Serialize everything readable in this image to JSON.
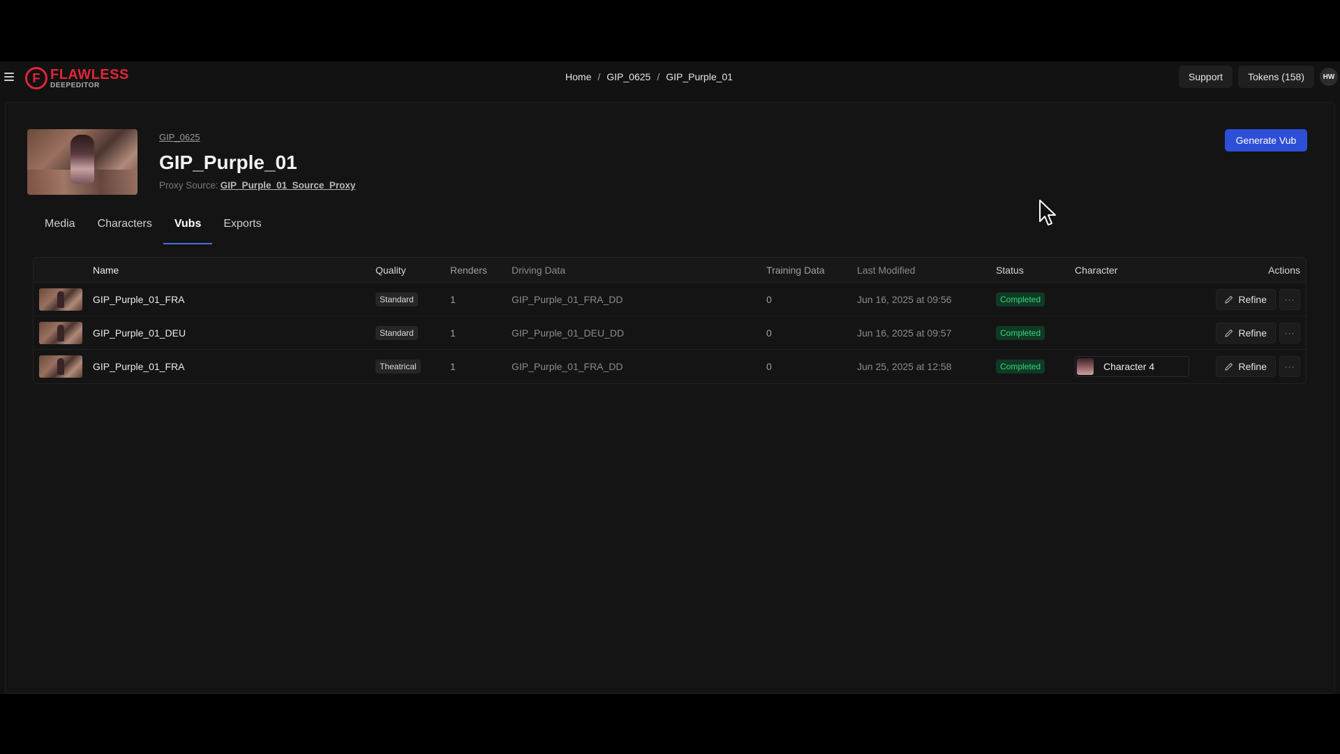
{
  "brand": {
    "name": "FLAWLESS",
    "sub": "DEEPEDITOR",
    "mark": "F"
  },
  "breadcrumb": {
    "home": "Home",
    "project": "GIP_0625",
    "current": "GIP_Purple_01",
    "separator": "/"
  },
  "topbar": {
    "support_label": "Support",
    "tokens_label": "Tokens (158)",
    "avatar_initials": "HW"
  },
  "header": {
    "project_link": "GIP_0625",
    "title": "GIP_Purple_01",
    "proxy_label": "Proxy Source:",
    "proxy_value": "GIP_Purple_01_Source_Proxy",
    "generate_label": "Generate Vub"
  },
  "tabs": [
    {
      "label": "Media",
      "active": false
    },
    {
      "label": "Characters",
      "active": false
    },
    {
      "label": "Vubs",
      "active": true
    },
    {
      "label": "Exports",
      "active": false
    }
  ],
  "table": {
    "columns": {
      "name": "Name",
      "quality": "Quality",
      "renders": "Renders",
      "driving": "Driving Data",
      "training": "Training Data",
      "modified": "Last Modified",
      "status": "Status",
      "character": "Character",
      "actions": "Actions"
    },
    "rows": [
      {
        "name": "GIP_Purple_01_FRA",
        "quality": "Standard",
        "renders": "1",
        "driving": "GIP_Purple_01_FRA_DD",
        "training": "0",
        "modified": "Jun 16, 2025 at 09:56",
        "status": "Completed",
        "character": "",
        "refine": "Refine",
        "more": "···"
      },
      {
        "name": "GIP_Purple_01_DEU",
        "quality": "Standard",
        "renders": "1",
        "driving": "GIP_Purple_01_DEU_DD",
        "training": "0",
        "modified": "Jun 16, 2025 at 09:57",
        "status": "Completed",
        "character": "",
        "refine": "Refine",
        "more": "···"
      },
      {
        "name": "GIP_Purple_01_FRA",
        "quality": "Theatrical",
        "renders": "1",
        "driving": "GIP_Purple_01_FRA_DD",
        "training": "0",
        "modified": "Jun 25, 2025 at 12:58",
        "status": "Completed",
        "character": "Character 4",
        "refine": "Refine",
        "more": "···"
      }
    ]
  },
  "colors": {
    "accent": "#2d4fd8",
    "brand": "#e0263a",
    "status_completed": "#3bd27d",
    "background": "#121212"
  }
}
